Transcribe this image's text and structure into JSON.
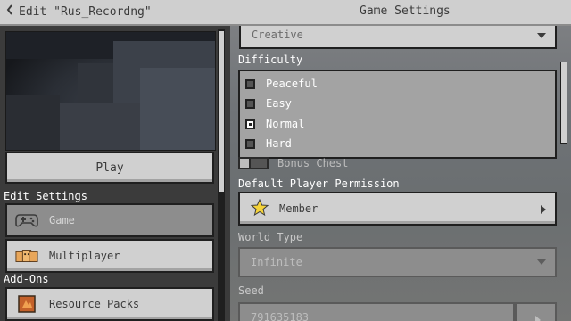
{
  "header": {
    "back_label": "Edit \"Rus_Recordng\"",
    "title": "Game Settings"
  },
  "sidebar": {
    "play_label": "Play",
    "edit_settings_label": "Edit Settings",
    "items": [
      {
        "label": "Game",
        "icon": "controller-icon",
        "selected": true
      },
      {
        "label": "Multiplayer",
        "icon": "multiplayer-icon"
      }
    ],
    "addons_label": "Add-Ons",
    "addon_items": [
      {
        "label": "Resource Packs",
        "icon": "resource-pack-icon"
      }
    ]
  },
  "settings": {
    "game_mode_value": "Creative",
    "difficulty_label": "Difficulty",
    "difficulty_options": [
      {
        "label": "Peaceful",
        "checked": false
      },
      {
        "label": "Easy",
        "checked": false
      },
      {
        "label": "Normal",
        "checked": true
      },
      {
        "label": "Hard",
        "checked": false
      }
    ],
    "bonus_chest_label": "Bonus Chest",
    "permission_label": "Default Player Permission",
    "permission_value": "Member",
    "world_type_label": "World Type",
    "world_type_value": "Infinite",
    "seed_label": "Seed",
    "seed_value": "791635183"
  },
  "colors": {
    "button_light": "#d0d0d0",
    "button_selected": "#8d8d8d",
    "header_bg": "#cfcfcf",
    "panel_dark": "#3b3b3b"
  }
}
